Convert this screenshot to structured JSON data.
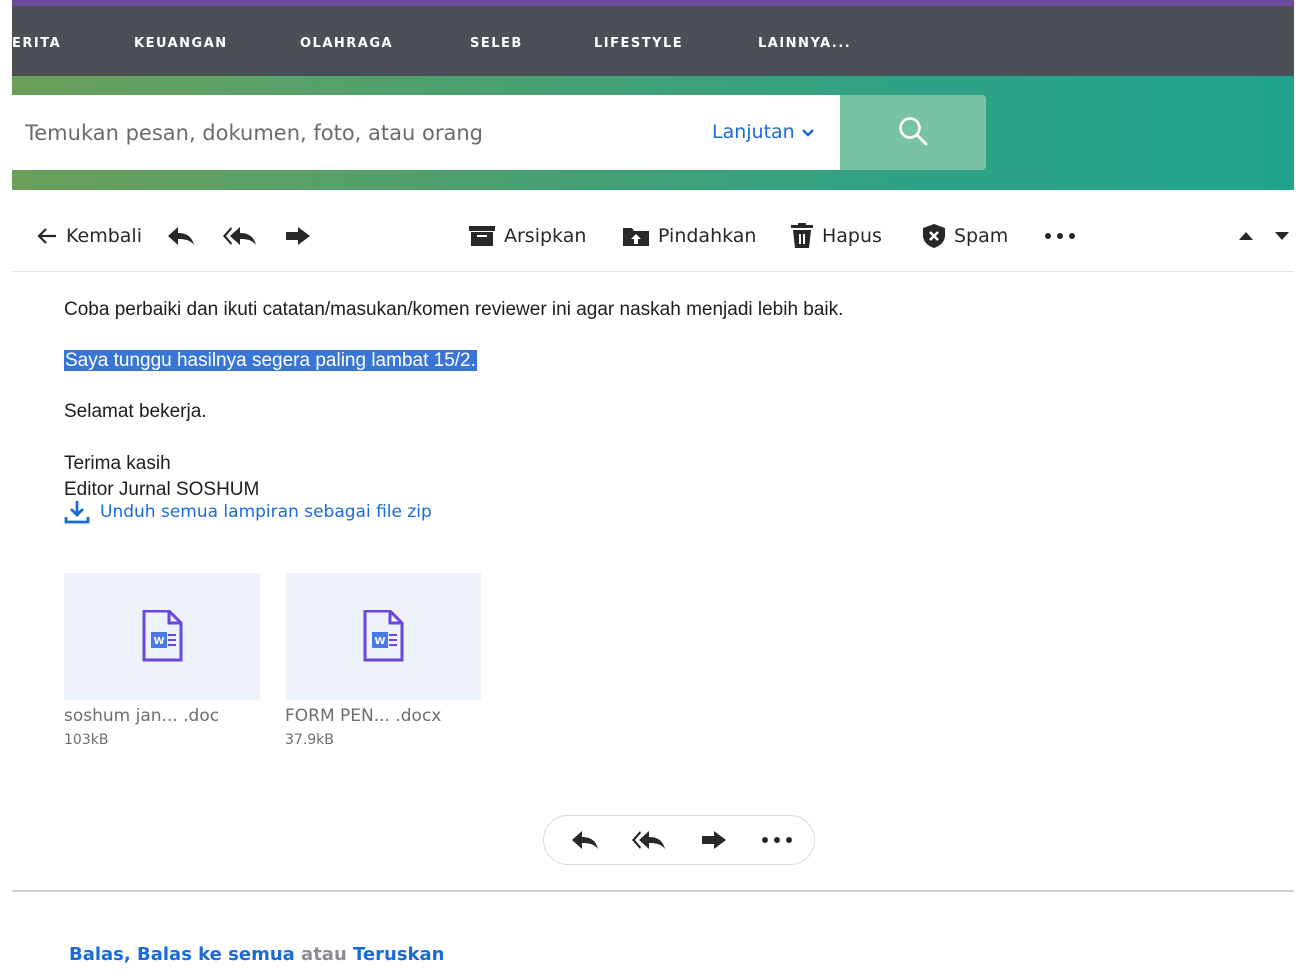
{
  "nav": {
    "items": [
      "ERITA",
      "KEUANGAN",
      "OLAHRAGA",
      "SELEB",
      "LIFESTYLE",
      "LAINNYA..."
    ]
  },
  "search": {
    "placeholder": "Temukan pesan, dokumen, foto, atau orang",
    "advanced_label": "Lanjutan"
  },
  "toolbar": {
    "back_label": "Kembali",
    "archive_label": "Arsipkan",
    "move_label": "Pindahkan",
    "delete_label": "Hapus",
    "spam_label": "Spam"
  },
  "message": {
    "line1": "Coba perbaiki dan ikuti catatan/masukan/komen reviewer ini agar naskah menjadi lebih baik.",
    "line2": "Saya tunggu hasilnya segera paling lambat 15/2.",
    "line3": "Selamat bekerja.",
    "line4": "Terima kasih",
    "line5": "Editor Jurnal SOSHUM"
  },
  "download_all": "Unduh semua lampiran sebagai file zip",
  "attachments": [
    {
      "name": "soshum jan...  .doc",
      "size": "103kB",
      "icon": "word-doc-icon"
    },
    {
      "name": "FORM PEN...  .docx",
      "size": "37.9kB",
      "icon": "word-doc-icon"
    }
  ],
  "quick_reply": {
    "reply": "Balas",
    "sep1": ", ",
    "reply_all": "Balas ke semua",
    "or": " atau ",
    "forward": "Teruskan"
  },
  "colors": {
    "nav_bg": "#4b4f56",
    "accent_stripe": "#6e4a9e",
    "link_blue": "#1a6bd8",
    "search_button": "#79c2a4",
    "selection": "#3875d7"
  }
}
